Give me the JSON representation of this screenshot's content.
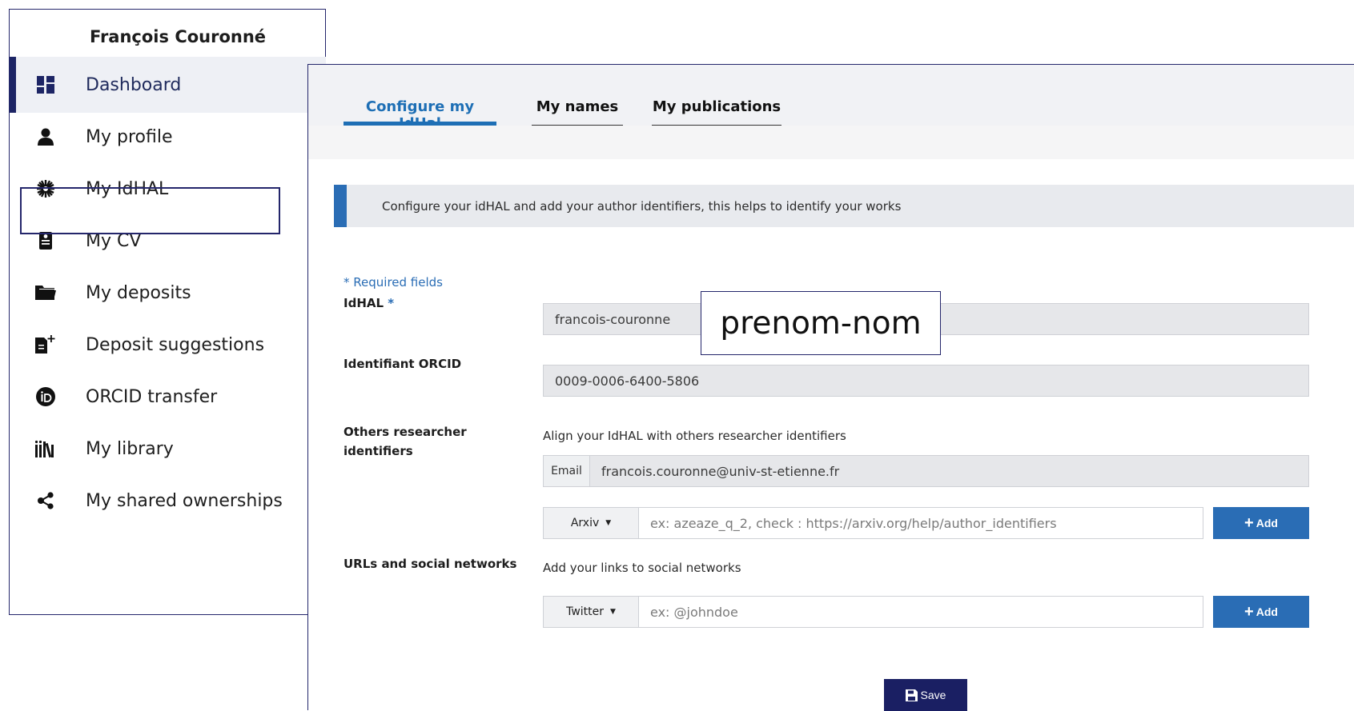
{
  "sidebar": {
    "user_name": "François Couronné",
    "items": [
      {
        "label": "Dashboard",
        "icon": "dashboard-icon"
      },
      {
        "label": "My profile",
        "icon": "user-icon"
      },
      {
        "label": "My IdHAL",
        "icon": "idhal-icon"
      },
      {
        "label": "My CV",
        "icon": "cv-icon"
      },
      {
        "label": "My deposits",
        "icon": "folder-icon"
      },
      {
        "label": "Deposit suggestions",
        "icon": "file-plus-icon"
      },
      {
        "label": "ORCID transfer",
        "icon": "orcid-icon"
      },
      {
        "label": "My library",
        "icon": "library-icon"
      },
      {
        "label": "My shared ownerships",
        "icon": "share-icon"
      }
    ]
  },
  "tabs": [
    {
      "label": "Configure my IdHal",
      "active": true
    },
    {
      "label": "My names",
      "active": false
    },
    {
      "label": "My publications",
      "active": false
    }
  ],
  "info_text": "Configure your idHAL and add your author identifiers, this helps to identify your works",
  "form": {
    "required_note": "* Required fields",
    "idhal_label": "IdHAL",
    "idhal_required_mark": "*",
    "idhal_value": "francois-couronne",
    "orcid_label": "Identifiant ORCID",
    "orcid_value": "0009-0006-6400-5806",
    "others_label": "Others researcher identifiers",
    "others_help": "Align your IdHAL with others researcher identifiers",
    "email_addon": "Email",
    "email_value": "francois.couronne@univ-st-etienne.fr",
    "arxiv_select": "Arxiv",
    "arxiv_placeholder": "ex: azeaze_q_2, check : https://arxiv.org/help/author_identifiers",
    "add_label": "Add",
    "urls_label": "URLs and social networks",
    "urls_help": "Add your links to social networks",
    "twitter_select": "Twitter",
    "twitter_placeholder": "ex: @johndoe",
    "save_label": "Save"
  },
  "callout_text": "prenom-nom",
  "colors": {
    "accent_blue": "#2a6db5",
    "navy": "#1a1f63",
    "frame": "#24266b"
  }
}
